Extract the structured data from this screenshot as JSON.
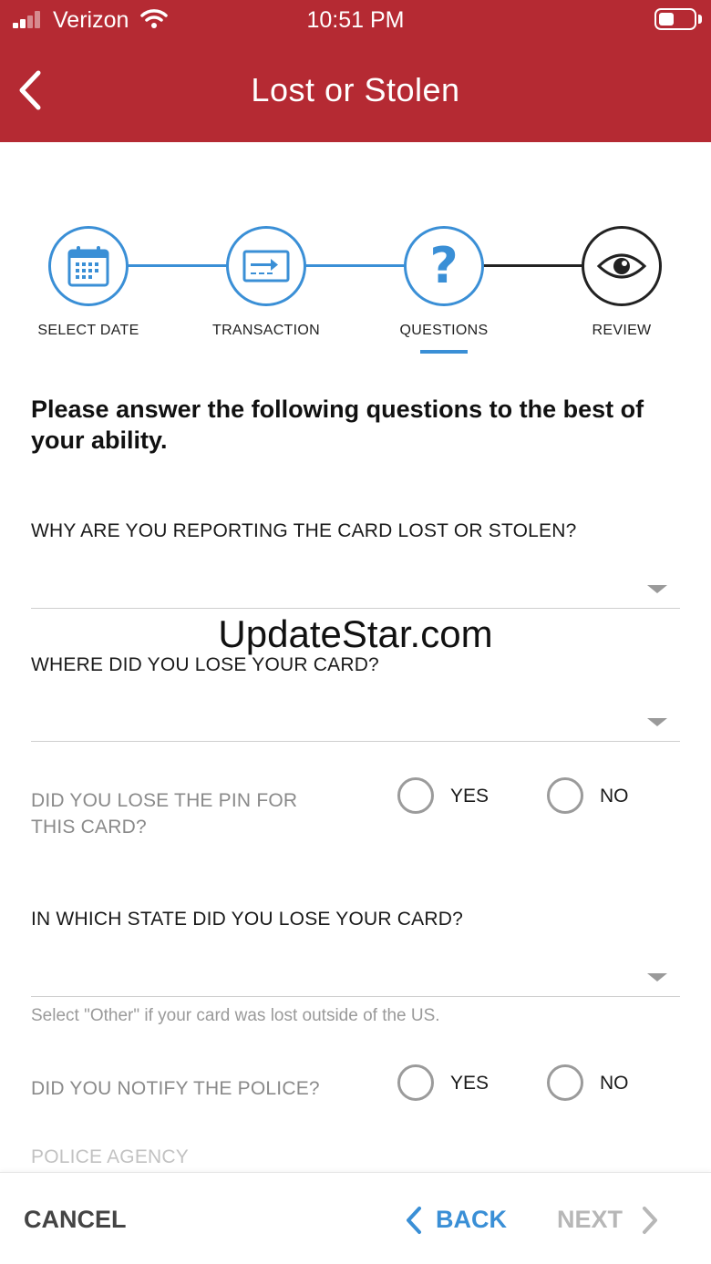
{
  "status_bar": {
    "carrier": "Verizon",
    "time": "10:51 PM"
  },
  "header": {
    "title": "Lost or Stolen"
  },
  "stepper": {
    "steps": [
      {
        "label": "SELECT DATE",
        "icon": "calendar-icon"
      },
      {
        "label": "TRANSACTION",
        "icon": "card-transfer-icon"
      },
      {
        "label": "QUESTIONS",
        "icon": "question-icon",
        "active": true
      },
      {
        "label": "REVIEW",
        "icon": "eye-icon"
      }
    ]
  },
  "form": {
    "intro": "Please answer the following questions to the best of your ability.",
    "q_reason": {
      "label": "WHY ARE YOU REPORTING THE CARD LOST OR STOLEN?",
      "value": ""
    },
    "q_where": {
      "label": "WHERE DID YOU LOSE YOUR CARD?",
      "value": ""
    },
    "q_pin": {
      "label_line1": "DID YOU LOSE THE PIN FOR",
      "label_line2": "THIS CARD?",
      "yes": "YES",
      "no": "NO"
    },
    "q_state": {
      "label": "IN WHICH STATE DID YOU LOSE YOUR CARD?",
      "value": "",
      "help": "Select \"Other\" if your card was lost outside of the US."
    },
    "q_police": {
      "label": "DID YOU NOTIFY THE POLICE?",
      "yes": "YES",
      "no": "NO"
    },
    "police_agency": {
      "label": "POLICE AGENCY"
    }
  },
  "watermark": "UpdateStar.com",
  "footer": {
    "cancel": "CANCEL",
    "back": "BACK",
    "next": "NEXT"
  },
  "colors": {
    "header": "#b52a33",
    "accent": "#3a8fd6",
    "disabled": "#b7b7b7"
  }
}
